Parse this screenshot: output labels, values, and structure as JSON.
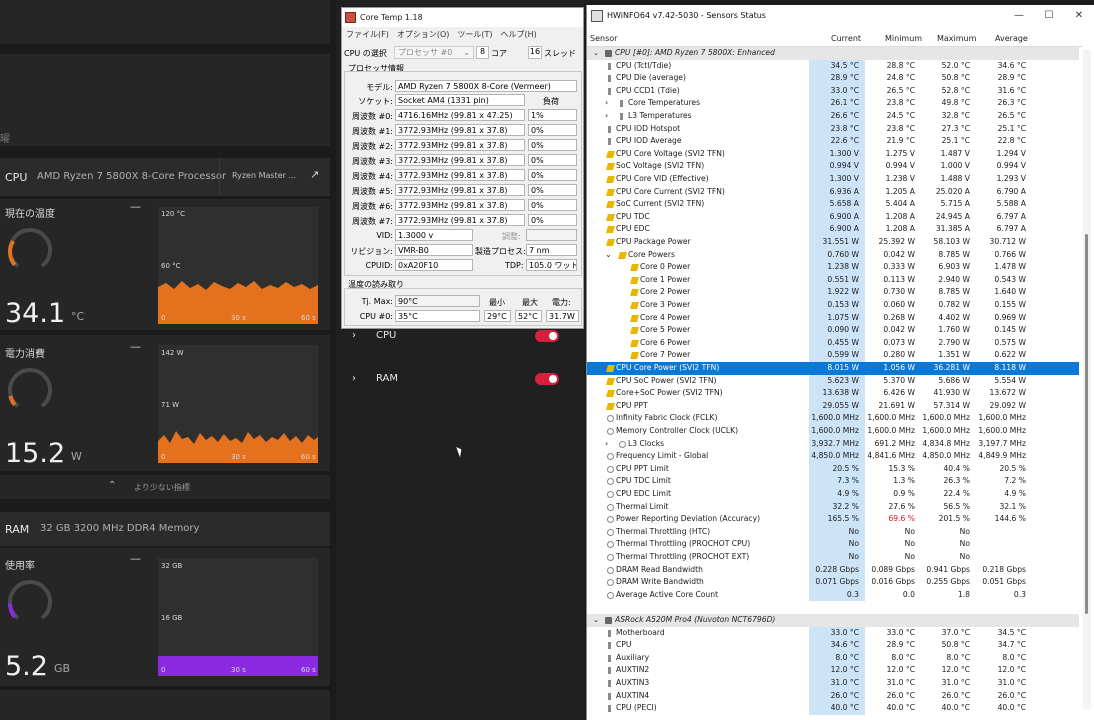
{
  "overlay": {
    "cpu": {
      "title": "CPU",
      "subtitle": "AMD Ryzen 7 5800X 8-Core Processor",
      "button": "Ryzen Master ...",
      "temp": {
        "label": "現在の温度",
        "value": "34.1",
        "unit": "°C",
        "graph": {
          "ytop": "120 °C",
          "ymid": "60 °C",
          "x0": "0",
          "x30": "30 s",
          "x60": "60 s"
        }
      },
      "power": {
        "label": "電力消費",
        "value": "15.2",
        "unit": "W",
        "graph": {
          "ytop": "142 W",
          "ymid": "71 W",
          "x0": "0",
          "x30": "30 s",
          "x60": "60 s"
        }
      },
      "fewer": "より少ない指標"
    },
    "ram": {
      "title": "RAM",
      "subtitle": "32 GB 3200 MHz DDR4 Memory",
      "usage": {
        "label": "使用率",
        "value": "5.2",
        "unit": "GB",
        "graph": {
          "ytop": "32 GB",
          "ymid": "16 GB",
          "x0": "0",
          "x30": "30 s",
          "x60": "60 s"
        }
      }
    },
    "dash": "—",
    "cpu_gauge": 0.28,
    "power_gauge": 0.11,
    "ram_gauge": 0.16
  },
  "mid": {
    "rows": [
      {
        "label": "CPU"
      },
      {
        "label": "RAM"
      }
    ]
  },
  "coretemp": {
    "title": "Core Temp 1.18",
    "menu": [
      "ファイル(F)",
      "オプション(O)",
      "ツール(T)",
      "ヘルプ(H)"
    ],
    "select_label": "CPU の選択",
    "select_value": "プロセッサ #0",
    "cores": "8",
    "cores_label": "コア",
    "threads": "16",
    "threads_label": "スレッド",
    "proc_info": "プロセッサ情報",
    "model_label": "モデル:",
    "model": "AMD Ryzen 7 5800X 8-Core (Vermeer)",
    "socket_label": "ソケット:",
    "socket": "Socket AM4 (1331 pin)",
    "load_label": "負荷",
    "freqs": [
      {
        "label": "周波数 #0:",
        "value": "4716.16MHz (99.81 x 47.25)",
        "load": "1%"
      },
      {
        "label": "周波数 #1:",
        "value": "3772.93MHz (99.81 x 37.8)",
        "load": "0%"
      },
      {
        "label": "周波数 #2:",
        "value": "3772.93MHz (99.81 x 37.8)",
        "load": "0%"
      },
      {
        "label": "周波数 #3:",
        "value": "3772.93MHz (99.81 x 37.8)",
        "load": "0%"
      },
      {
        "label": "周波数 #4:",
        "value": "3772.93MHz (99.81 x 37.8)",
        "load": "0%"
      },
      {
        "label": "周波数 #5:",
        "value": "3772.93MHz (99.81 x 37.8)",
        "load": "0%"
      },
      {
        "label": "周波数 #6:",
        "value": "3772.93MHz (99.81 x 37.8)",
        "load": "0%"
      },
      {
        "label": "周波数 #7:",
        "value": "3772.93MHz (99.81 x 37.8)",
        "load": "0%"
      }
    ],
    "vid_label": "VID:",
    "vid": "1.3000 v",
    "modulation": "調整:",
    "rev_label": "リビジョン:",
    "rev": "VMR-B0",
    "process_label": "製造プロセス:",
    "process": "7 nm",
    "cpuid_label": "CPUID:",
    "cpuid": "0xA20F10",
    "tdp_label": "TDP:",
    "tdp": "105.0 ワット",
    "temp_reading": "温度の読み取り",
    "tjmax_label": "Tj. Max:",
    "tjmax": "90°C",
    "min_label": "最小",
    "max_label": "最大",
    "power_label": "電力:",
    "cpu0_label": "CPU #0:",
    "cpu0": "35°C",
    "cpu0_min": "29°C",
    "cpu0_max": "52°C",
    "cpu0_power": "31.7W"
  },
  "hwinfo": {
    "title": "HWiNFO64 v7.42-5030 - Sensors Status",
    "columns": [
      "Sensor",
      "Current",
      "Minimum",
      "Maximum",
      "Average"
    ],
    "rows": [
      {
        "n": "CPU [#0]: AMD Ryzen 7 5800X: Enhanced",
        "g": 1,
        "i": "chip"
      },
      {
        "n": "CPU (Tctl/Tdie)",
        "c": "34.5 °C",
        "mi": "28.8 °C",
        "ma": "52.0 °C",
        "av": "34.6 °C",
        "i": "temp"
      },
      {
        "n": "CPU Die (average)",
        "c": "28.9 °C",
        "mi": "24.8 °C",
        "ma": "50.8 °C",
        "av": "28.9 °C",
        "i": "temp"
      },
      {
        "n": "CPU CCD1 (Tdie)",
        "c": "33.0 °C",
        "mi": "26.5 °C",
        "ma": "52.8 °C",
        "av": "31.6 °C",
        "i": "temp"
      },
      {
        "n": "Core Temperatures",
        "c": "26.1 °C",
        "mi": "23.8 °C",
        "ma": "49.8 °C",
        "av": "26.3 °C",
        "i": "temp",
        "e": 1,
        "x": 1
      },
      {
        "n": "L3 Temperatures",
        "c": "26.6 °C",
        "mi": "24.5 °C",
        "ma": "32.8 °C",
        "av": "26.5 °C",
        "i": "temp",
        "e": 1,
        "x": 1
      },
      {
        "n": "CPU IOD Hotspot",
        "c": "23.8 °C",
        "mi": "23.8 °C",
        "ma": "27.3 °C",
        "av": "25.1 °C",
        "i": "temp"
      },
      {
        "n": "CPU IOD Average",
        "c": "22.6 °C",
        "mi": "21.9 °C",
        "ma": "25.1 °C",
        "av": "22.8 °C",
        "i": "temp"
      },
      {
        "n": "CPU Core Voltage (SVI2 TFN)",
        "c": "1.300 V",
        "mi": "1.275 V",
        "ma": "1.487 V",
        "av": "1.294 V",
        "i": "bolt"
      },
      {
        "n": "SoC Voltage (SVI2 TFN)",
        "c": "0.994 V",
        "mi": "0.994 V",
        "ma": "1.000 V",
        "av": "0.994 V",
        "i": "bolt"
      },
      {
        "n": "CPU Core VID (Effective)",
        "c": "1.300 V",
        "mi": "1.238 V",
        "ma": "1.488 V",
        "av": "1.293 V",
        "i": "bolt"
      },
      {
        "n": "CPU Core Current (SVI2 TFN)",
        "c": "6.936 A",
        "mi": "1.205 A",
        "ma": "25.020 A",
        "av": "6.790 A",
        "i": "bolt"
      },
      {
        "n": "SoC Current (SVI2 TFN)",
        "c": "5.658 A",
        "mi": "5.404 A",
        "ma": "5.715 A",
        "av": "5.588 A",
        "i": "bolt"
      },
      {
        "n": "CPU TDC",
        "c": "6.900 A",
        "mi": "1.208 A",
        "ma": "24.945 A",
        "av": "6.797 A",
        "i": "bolt"
      },
      {
        "n": "CPU EDC",
        "c": "6.900 A",
        "mi": "1.208 A",
        "ma": "31.385 A",
        "av": "6.797 A",
        "i": "bolt"
      },
      {
        "n": "CPU Package Power",
        "c": "31.551 W",
        "mi": "25.392 W",
        "ma": "58.103 W",
        "av": "30.712 W",
        "i": "bolt"
      },
      {
        "n": "Core Powers",
        "c": "0.760 W",
        "mi": "0.042 W",
        "ma": "8.785 W",
        "av": "0.766 W",
        "i": "bolt",
        "e": 2,
        "x": 1
      },
      {
        "n": "Core 0 Power",
        "c": "1.238 W",
        "mi": "0.333 W",
        "ma": "6.903 W",
        "av": "1.478 W",
        "i": "bolt",
        "x": 2
      },
      {
        "n": "Core 1 Power",
        "c": "0.551 W",
        "mi": "0.113 W",
        "ma": "2.940 W",
        "av": "0.543 W",
        "i": "bolt",
        "x": 2
      },
      {
        "n": "Core 2 Power",
        "c": "1.922 W",
        "mi": "0.730 W",
        "ma": "8.785 W",
        "av": "1.640 W",
        "i": "bolt",
        "x": 2
      },
      {
        "n": "Core 3 Power",
        "c": "0.153 W",
        "mi": "0.060 W",
        "ma": "0.782 W",
        "av": "0.155 W",
        "i": "bolt",
        "x": 2
      },
      {
        "n": "Core 4 Power",
        "c": "1.075 W",
        "mi": "0.268 W",
        "ma": "4.402 W",
        "av": "0.969 W",
        "i": "bolt",
        "x": 2
      },
      {
        "n": "Core 5 Power",
        "c": "0.090 W",
        "mi": "0.042 W",
        "ma": "1.760 W",
        "av": "0.145 W",
        "i": "bolt",
        "x": 2
      },
      {
        "n": "Core 6 Power",
        "c": "0.455 W",
        "mi": "0.073 W",
        "ma": "2.790 W",
        "av": "0.575 W",
        "i": "bolt",
        "x": 2
      },
      {
        "n": "Core 7 Power",
        "c": "0.599 W",
        "mi": "0.280 W",
        "ma": "1.351 W",
        "av": "0.622 W",
        "i": "bolt",
        "x": 2
      },
      {
        "n": "CPU Core Power (SVI2 TFN)",
        "c": "8.015 W",
        "mi": "1.056 W",
        "ma": "36.281 W",
        "av": "8.118 W",
        "i": "bolt",
        "s": 1
      },
      {
        "n": "CPU SoC Power (SVI2 TFN)",
        "c": "5.623 W",
        "mi": "5.370 W",
        "ma": "5.686 W",
        "av": "5.554 W",
        "i": "bolt"
      },
      {
        "n": "Core+SoC Power (SVI2 TFN)",
        "c": "13.638 W",
        "mi": "6.426 W",
        "ma": "41.930 W",
        "av": "13.672 W",
        "i": "bolt"
      },
      {
        "n": "CPU PPT",
        "c": "29.055 W",
        "mi": "21.691 W",
        "ma": "57.314 W",
        "av": "29.092 W",
        "i": "bolt"
      },
      {
        "n": "Infinity Fabric Clock (FCLK)",
        "c": "1,600.0 MHz",
        "mi": "1,600.0 MHz",
        "ma": "1,600.0 MHz",
        "av": "1,600.0 MHz",
        "i": "clock"
      },
      {
        "n": "Memory Controller Clock (UCLK)",
        "c": "1,600.0 MHz",
        "mi": "1,600.0 MHz",
        "ma": "1,600.0 MHz",
        "av": "1,600.0 MHz",
        "i": "clock"
      },
      {
        "n": "L3 Clocks",
        "c": "3,932.7 MHz",
        "mi": "691.2 MHz",
        "ma": "4,834.8 MHz",
        "av": "3,197.7 MHz",
        "i": "clock",
        "e": 1,
        "x": 1
      },
      {
        "n": "Frequency Limit - Global",
        "c": "4,850.0 MHz",
        "mi": "4,841.6 MHz",
        "ma": "4,850.0 MHz",
        "av": "4,849.9 MHz",
        "i": "clock"
      },
      {
        "n": "CPU PPT Limit",
        "c": "20.5 %",
        "mi": "15.3 %",
        "ma": "40.4 %",
        "av": "20.5 %",
        "i": "clock"
      },
      {
        "n": "CPU TDC Limit",
        "c": "7.3 %",
        "mi": "1.3 %",
        "ma": "26.3 %",
        "av": "7.2 %",
        "i": "clock"
      },
      {
        "n": "CPU EDC Limit",
        "c": "4.9 %",
        "mi": "0.9 %",
        "ma": "22.4 %",
        "av": "4.9 %",
        "i": "clock"
      },
      {
        "n": "Thermal Limit",
        "c": "32.2 %",
        "mi": "27.6 %",
        "ma": "56.5 %",
        "av": "32.1 %",
        "i": "clock"
      },
      {
        "n": "Power Reporting Deviation (Accuracy)",
        "c": "165.5 %",
        "mi": "69.6 %",
        "ma": "201.5 %",
        "av": "144.6 %",
        "i": "clock",
        "r": 1
      },
      {
        "n": "Thermal Throttling (HTC)",
        "c": "No",
        "mi": "No",
        "ma": "No",
        "av": "",
        "i": "clock"
      },
      {
        "n": "Thermal Throttling (PROCHOT CPU)",
        "c": "No",
        "mi": "No",
        "ma": "No",
        "av": "",
        "i": "clock"
      },
      {
        "n": "Thermal Throttling (PROCHOT EXT)",
        "c": "No",
        "mi": "No",
        "ma": "No",
        "av": "",
        "i": "clock"
      },
      {
        "n": "DRAM Read Bandwidth",
        "c": "0.228 Gbps",
        "mi": "0.089 Gbps",
        "ma": "0.941 Gbps",
        "av": "0.218 Gbps",
        "i": "clock"
      },
      {
        "n": "DRAM Write Bandwidth",
        "c": "0.071 Gbps",
        "mi": "0.016 Gbps",
        "ma": "0.255 Gbps",
        "av": "0.051 Gbps",
        "i": "clock"
      },
      {
        "n": "Average Active Core Count",
        "c": "0.3",
        "mi": "0.0",
        "ma": "1.8",
        "av": "0.3",
        "i": "clock"
      },
      {
        "n": "",
        "b": 1
      },
      {
        "n": "ASRock A520M Pro4 (Nuvoton NCT6796D)",
        "g": 1,
        "i": "chip"
      },
      {
        "n": "Motherboard",
        "c": "33.0 °C",
        "mi": "33.0 °C",
        "ma": "37.0 °C",
        "av": "34.5 °C",
        "i": "temp"
      },
      {
        "n": "CPU",
        "c": "34.6 °C",
        "mi": "28.9 °C",
        "ma": "50.8 °C",
        "av": "34.7 °C",
        "i": "temp"
      },
      {
        "n": "Auxiliary",
        "c": "8.0 °C",
        "mi": "8.0 °C",
        "ma": "8.0 °C",
        "av": "8.0 °C",
        "i": "temp"
      },
      {
        "n": "AUXTIN2",
        "c": "12.0 °C",
        "mi": "12.0 °C",
        "ma": "12.0 °C",
        "av": "12.0 °C",
        "i": "temp"
      },
      {
        "n": "AUXTIN3",
        "c": "31.0 °C",
        "mi": "31.0 °C",
        "ma": "31.0 °C",
        "av": "31.0 °C",
        "i": "temp"
      },
      {
        "n": "AUXTIN4",
        "c": "26.0 °C",
        "mi": "26.0 °C",
        "ma": "26.0 °C",
        "av": "26.0 °C",
        "i": "temp"
      },
      {
        "n": "CPU (PECI)",
        "c": "40.0 °C",
        "mi": "40.0 °C",
        "ma": "40.0 °C",
        "av": "40.0 °C",
        "i": "temp"
      }
    ]
  },
  "colors": {
    "accent_orange": "#e4711e",
    "ram_purple": "#8a2be2",
    "toggle_red": "#d6203c",
    "hw_select": "#0a78d7",
    "hw_current_bg": "#cde3f7"
  }
}
